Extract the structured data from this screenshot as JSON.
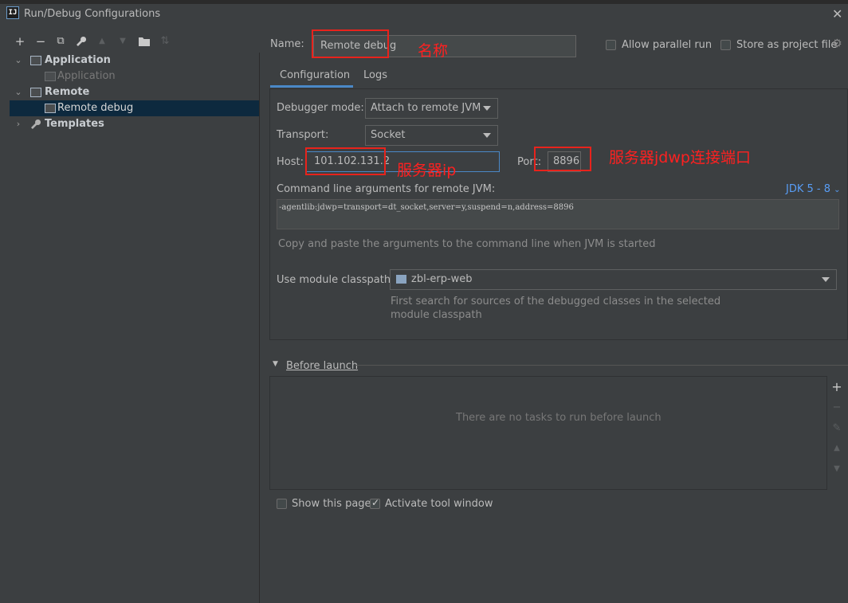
{
  "window": {
    "title": "Run/Debug Configurations",
    "app_icon_text": "IJ"
  },
  "toolbar": [
    {
      "name": "add-icon",
      "glyph": "+"
    },
    {
      "name": "remove-icon",
      "glyph": "−"
    },
    {
      "name": "copy-icon",
      "glyph": "⧉"
    },
    {
      "name": "wrench-icon",
      "glyph": "🔧"
    },
    {
      "name": "move-up-icon",
      "glyph": "▲"
    },
    {
      "name": "move-down-icon",
      "glyph": "▼"
    },
    {
      "name": "folder-icon",
      "glyph": "▰"
    },
    {
      "name": "sort-icon",
      "glyph": "⇅"
    }
  ],
  "tree": {
    "application": "Application",
    "application_child": "Application",
    "remote": "Remote",
    "remote_child": "Remote debug",
    "templates": "Templates"
  },
  "form": {
    "name_label": "Name:",
    "name_value": "Remote debug",
    "allow_parallel": "Allow parallel run",
    "store_project": "Store as project file",
    "tabs": [
      "Configuration",
      "Logs"
    ],
    "debugger_mode_label": "Debugger mode:",
    "debugger_mode_value": "Attach to remote JVM",
    "transport_label": "Transport:",
    "transport_value": "Socket",
    "host_label": "Host:",
    "host_value": "101.102.131.2",
    "port_label": "Port:",
    "port_value": "8896",
    "cmd_label": "Command line arguments for remote JVM:",
    "jdk_select": "JDK 5 - 8",
    "cmd_value": "-agentlib:jdwp=transport=dt_socket,server=y,suspend=n,address=8896",
    "cmd_hint": "Copy and paste the arguments to the command line when JVM is started",
    "module_label": "Use module classpath:",
    "module_value": "zbl-erp-web",
    "module_hint_1": "First search for sources of the debugged classes in the selected",
    "module_hint_2": "module classpath",
    "before_launch": "Before launch",
    "no_tasks": "There are no tasks to run before launch",
    "show_page": "Show this page",
    "activate_tool": "Activate tool window"
  },
  "annotations": {
    "name_note": "名称",
    "host_note": "服务器ip",
    "port_note": "服务器jdwp连接端口"
  },
  "colors": {
    "accent": "#4a88c7",
    "annotation": "#e8231c",
    "selection": "#0d293e"
  }
}
